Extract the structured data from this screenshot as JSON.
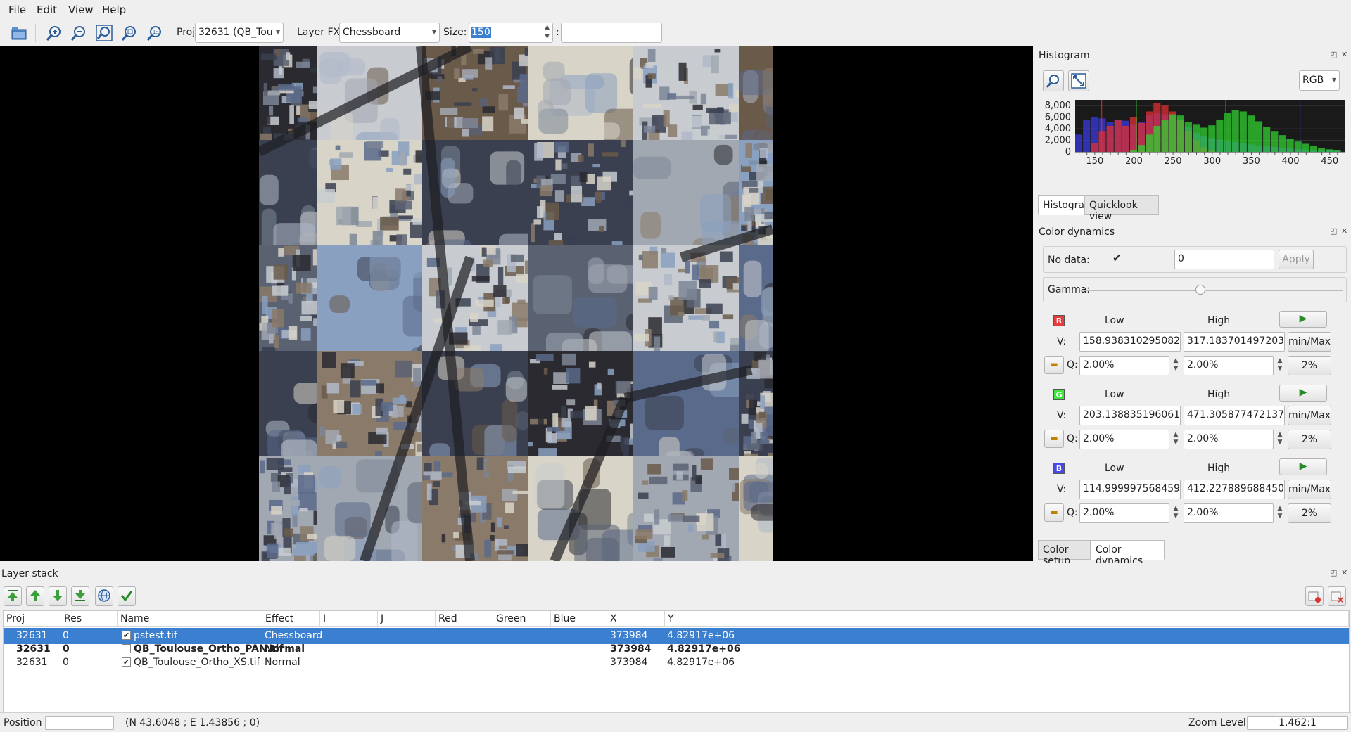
{
  "menu": {
    "file": "File",
    "edit": "Edit",
    "view": "View",
    "help": "Help"
  },
  "toolbar": {
    "proj_label": "Proj",
    "proj_value": "32631 (QB_Tou",
    "layer_fx_label": "Layer FX",
    "layer_fx_value": "Chessboard",
    "size_label": "Size:",
    "size_value": "150",
    "size_sep": ":",
    "icons": [
      "open-icon",
      "zoom-in-icon",
      "zoom-out-icon",
      "zoom-extent-icon",
      "zoom-full-res-icon",
      "zoom-layer-icon"
    ]
  },
  "histogram_panel": {
    "title": "Histogram",
    "mode": "RGB",
    "y_ticks": [
      "8,000",
      "6,000",
      "4,000",
      "2,000",
      "0"
    ],
    "x_ticks": [
      "150",
      "200",
      "250",
      "300",
      "350",
      "400",
      "450"
    ],
    "tabs": [
      "Histogram",
      "Quicklook view"
    ],
    "active_tab": "Histogram",
    "colors": {
      "red": "#e03030",
      "green": "#30d030",
      "blue": "#4040e0",
      "bg": "#1a1a1a"
    }
  },
  "chart_data": {
    "type": "bar",
    "xlim": [
      125,
      470
    ],
    "ylim": [
      0,
      9000
    ],
    "series": [
      {
        "color": "#3a3ae0",
        "values_x": [
          130,
          140,
          150,
          160,
          170,
          180,
          190,
          200,
          210,
          220,
          230,
          240,
          250,
          260,
          270,
          280,
          290,
          300,
          310,
          320,
          330,
          340,
          350,
          360,
          370,
          380,
          390,
          400,
          410,
          420,
          430,
          440,
          450,
          460
        ],
        "values": [
          3000,
          5500,
          6000,
          5800,
          5200,
          5500,
          5400,
          4700,
          5200,
          6300,
          6800,
          6500,
          5900,
          5400,
          4300,
          3300,
          2700,
          2400,
          2100,
          1900,
          1700,
          1500,
          1300,
          1100,
          950,
          850,
          700,
          600,
          500,
          400,
          350,
          300,
          250,
          200
        ]
      },
      {
        "color": "#e03030",
        "values_x": [
          150,
          160,
          170,
          180,
          190,
          200,
          210,
          220,
          230,
          240,
          250,
          260,
          270,
          280,
          290,
          300
        ],
        "values": [
          1500,
          3500,
          4500,
          5500,
          4500,
          6000,
          5000,
          7000,
          8500,
          8000,
          7000,
          5500,
          3500,
          2000,
          800,
          200
        ]
      },
      {
        "color": "#30d030",
        "values_x": [
          200,
          210,
          220,
          230,
          240,
          250,
          260,
          270,
          280,
          290,
          300,
          310,
          320,
          330,
          340,
          350,
          360,
          370,
          380,
          390,
          400,
          410,
          420,
          430,
          440,
          450,
          460
        ],
        "values": [
          300,
          1200,
          3000,
          4500,
          5500,
          6500,
          6300,
          5200,
          4700,
          4200,
          4600,
          5600,
          6800,
          7200,
          7000,
          6300,
          5300,
          4300,
          3500,
          2900,
          2300,
          1800,
          1400,
          1000,
          700,
          450,
          250
        ]
      }
    ],
    "markers": [
      {
        "x": 158.9,
        "color": "#e03030"
      },
      {
        "x": 317.2,
        "color": "#e03030"
      },
      {
        "x": 203.1,
        "color": "#30d030"
      },
      {
        "x": 471.3,
        "color": "#30d030"
      },
      {
        "x": 115.0,
        "color": "#4040e0"
      },
      {
        "x": 412.2,
        "color": "#4040e0"
      }
    ]
  },
  "color_dynamics": {
    "title": "Color dynamics",
    "no_data_label": "No data:",
    "no_data_value": "0",
    "apply": "Apply",
    "gamma_label": "Gamma:",
    "gamma_level": 0.45,
    "low": "Low",
    "high": "High",
    "v_label": "V:",
    "q_label": "Q:",
    "minmax": "min/Max",
    "two_pct": "2%",
    "channels": [
      {
        "name": "R",
        "color": "#e83c3c",
        "low_v": "158.938310295082",
        "high_v": "317.183701497203",
        "low_q": "2.00%",
        "high_q": "2.00%"
      },
      {
        "name": "G",
        "color": "#3ce83c",
        "low_v": "203.138835196061",
        "high_v": "471.305877472137",
        "low_q": "2.00%",
        "high_q": "2.00%"
      },
      {
        "name": "B",
        "color": "#4848e8",
        "low_v": "114.999997568459",
        "high_v": "412.227889688450",
        "low_q": "2.00%",
        "high_q": "2.00%"
      }
    ],
    "tabs": [
      "Color setup",
      "Color dynamics"
    ],
    "active_tab": "Color dynamics"
  },
  "layer_stack": {
    "title": "Layer stack",
    "columns": [
      "Proj",
      "Res",
      "Name",
      "Effect",
      "I",
      "J",
      "Red",
      "Green",
      "Blue",
      "X",
      "Y"
    ],
    "rows": [
      {
        "proj": "32631",
        "res": "0",
        "checked": true,
        "name": "pstest.tif",
        "effect": "Chessboard",
        "x": "373984",
        "y": "4.82917e+06",
        "selected": true,
        "bold": false
      },
      {
        "proj": "32631",
        "res": "0",
        "checked": false,
        "name": "QB_Toulouse_Ortho_PAN.tif",
        "effect": "Normal",
        "x": "373984",
        "y": "4.82917e+06",
        "selected": false,
        "bold": true
      },
      {
        "proj": "32631",
        "res": "0",
        "checked": true,
        "name": "QB_Toulouse_Ortho_XS.tif",
        "effect": "Normal",
        "x": "373984",
        "y": "4.82917e+06",
        "selected": false,
        "bold": false
      }
    ]
  },
  "status": {
    "position_label": "Position",
    "coords": "(N 43.6048 ; E 1.43856 ; 0)",
    "zoom_label": "Zoom Level",
    "zoom_value": "1.462:1"
  }
}
